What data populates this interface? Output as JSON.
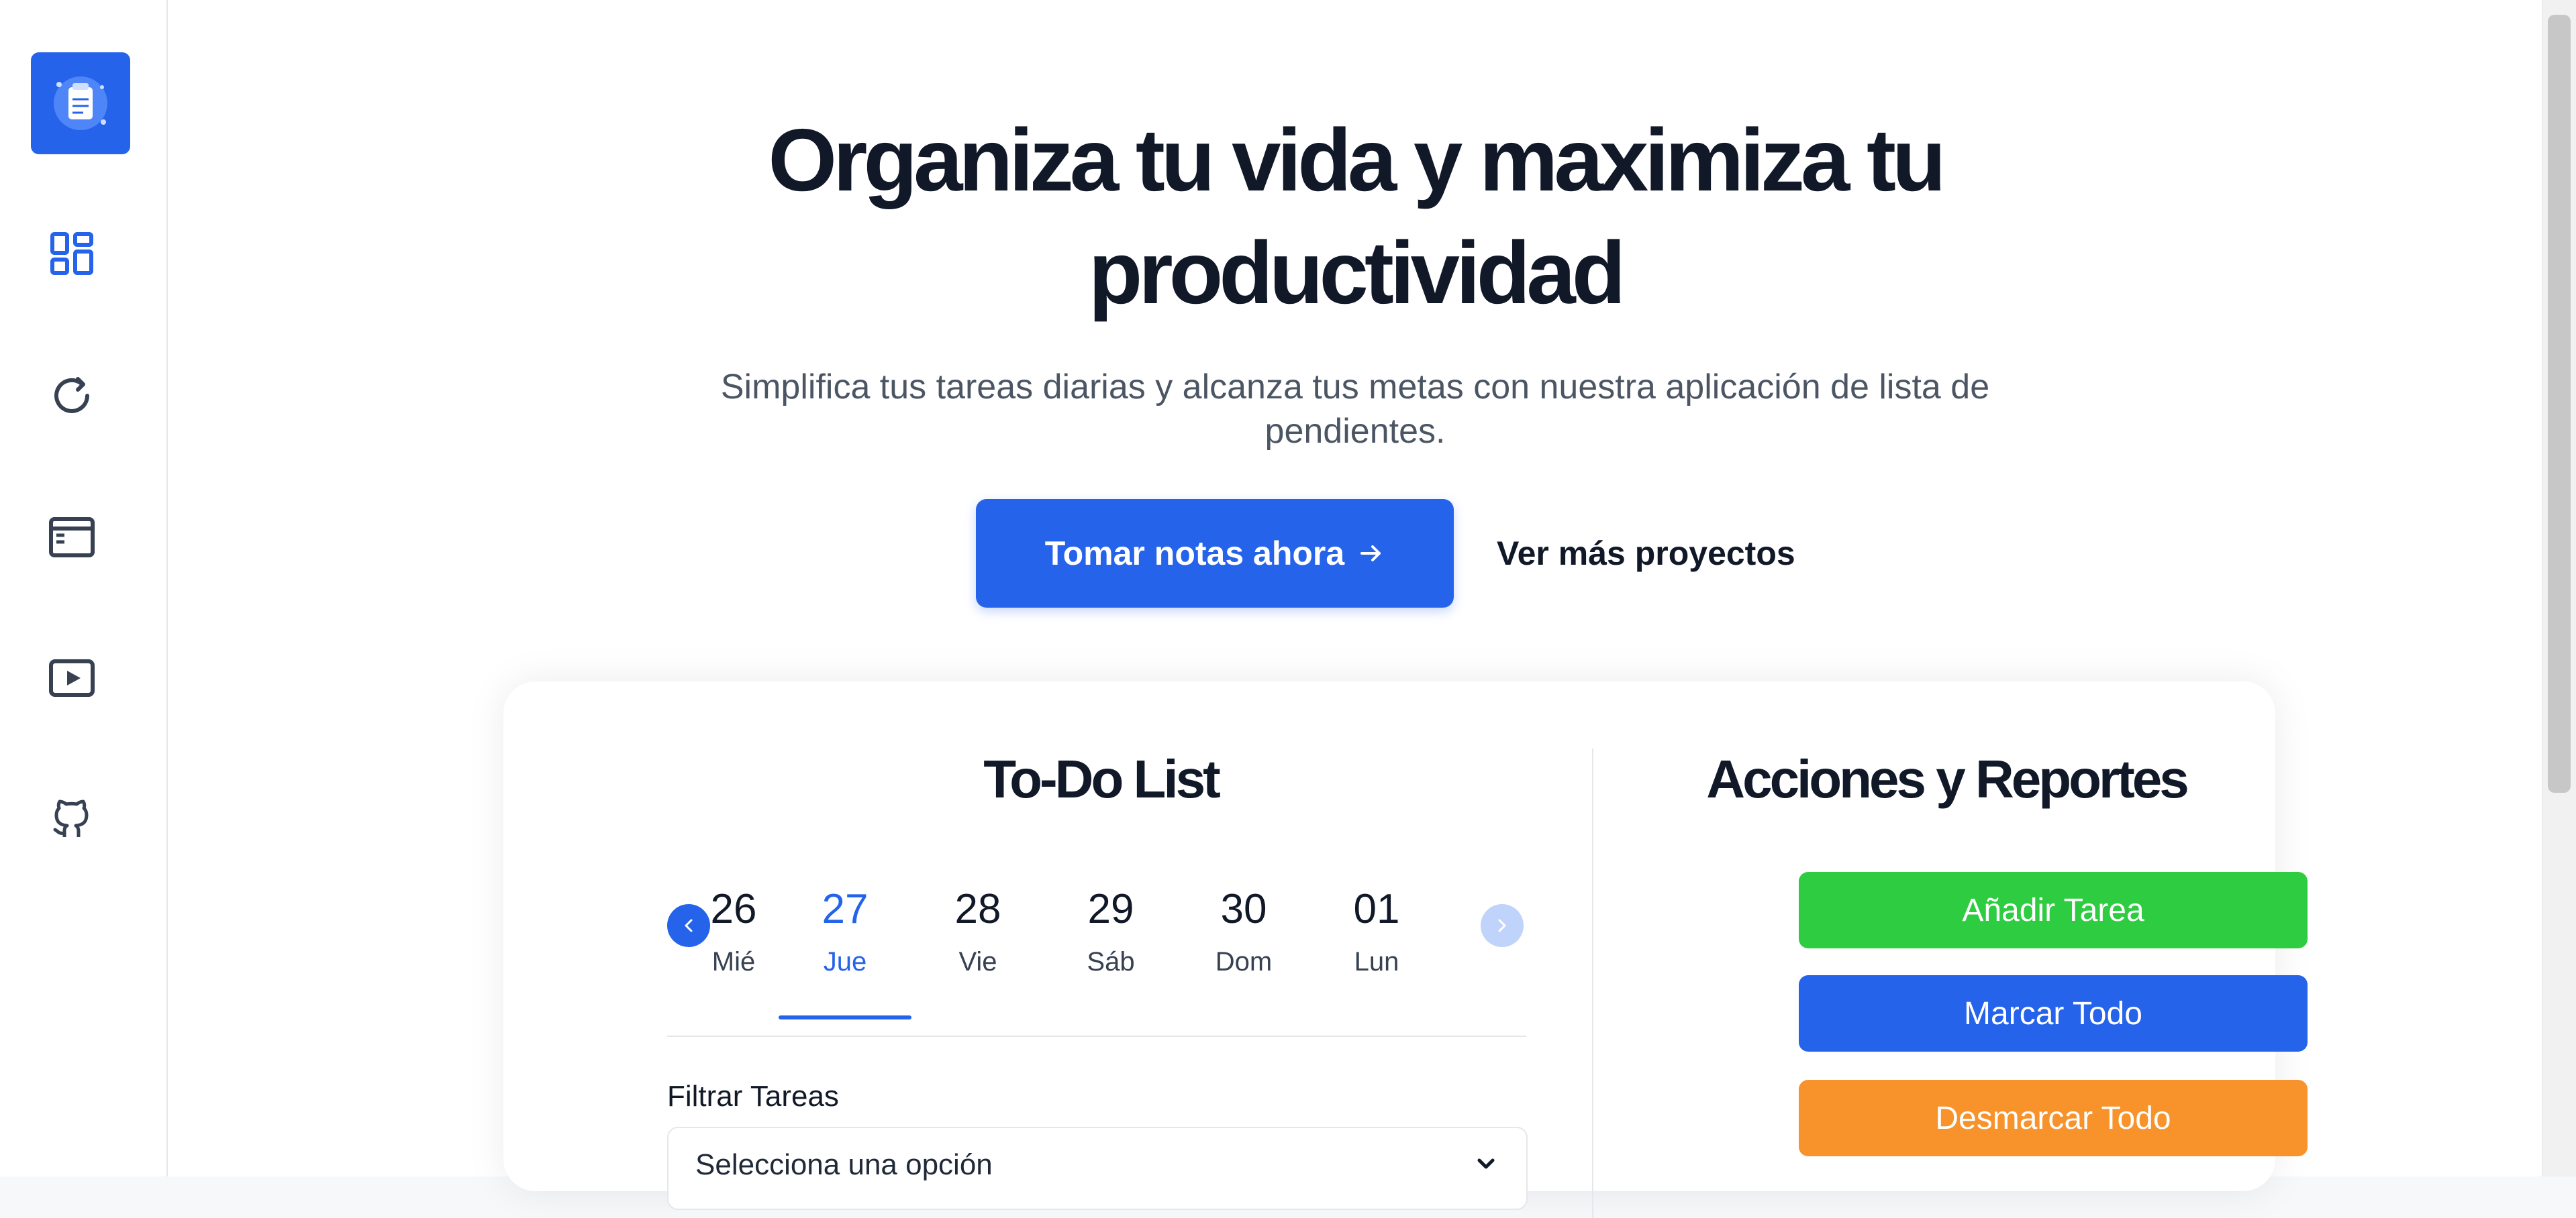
{
  "hero": {
    "title_line1": "Organiza tu vida y maximiza tu",
    "title_line2": "productividad",
    "subtitle_line1": "Simplifica tus tareas diarias y alcanza tus metas con nuestra aplicación de lista de",
    "subtitle_line2": "pendientes.",
    "cta_label": "Tomar notas ahora",
    "secondary_label": "Ver más proyectos"
  },
  "sidebar": {
    "icons": [
      "app-logo-icon",
      "dashboard-icon",
      "refresh-icon",
      "window-icon",
      "video-icon",
      "github-icon"
    ]
  },
  "todo": {
    "title": "To-Do List",
    "dates": [
      {
        "num": "26",
        "day": "Mié"
      },
      {
        "num": "27",
        "day": "Jue",
        "active": true
      },
      {
        "num": "28",
        "day": "Vie"
      },
      {
        "num": "29",
        "day": "Sáb"
      },
      {
        "num": "30",
        "day": "Dom"
      },
      {
        "num": "01",
        "day": "Lun"
      }
    ],
    "filter_label": "Filtrar Tareas",
    "filter_placeholder": "Selecciona una opción"
  },
  "actions": {
    "title": "Acciones y Reportes",
    "add_label": "Añadir Tarea",
    "mark_all_label": "Marcar Todo",
    "unmark_all_label": "Desmarcar Todo"
  },
  "colors": {
    "primary": "#2563eb",
    "green": "#2ecc40",
    "orange": "#f7932a",
    "text": "#111827"
  }
}
